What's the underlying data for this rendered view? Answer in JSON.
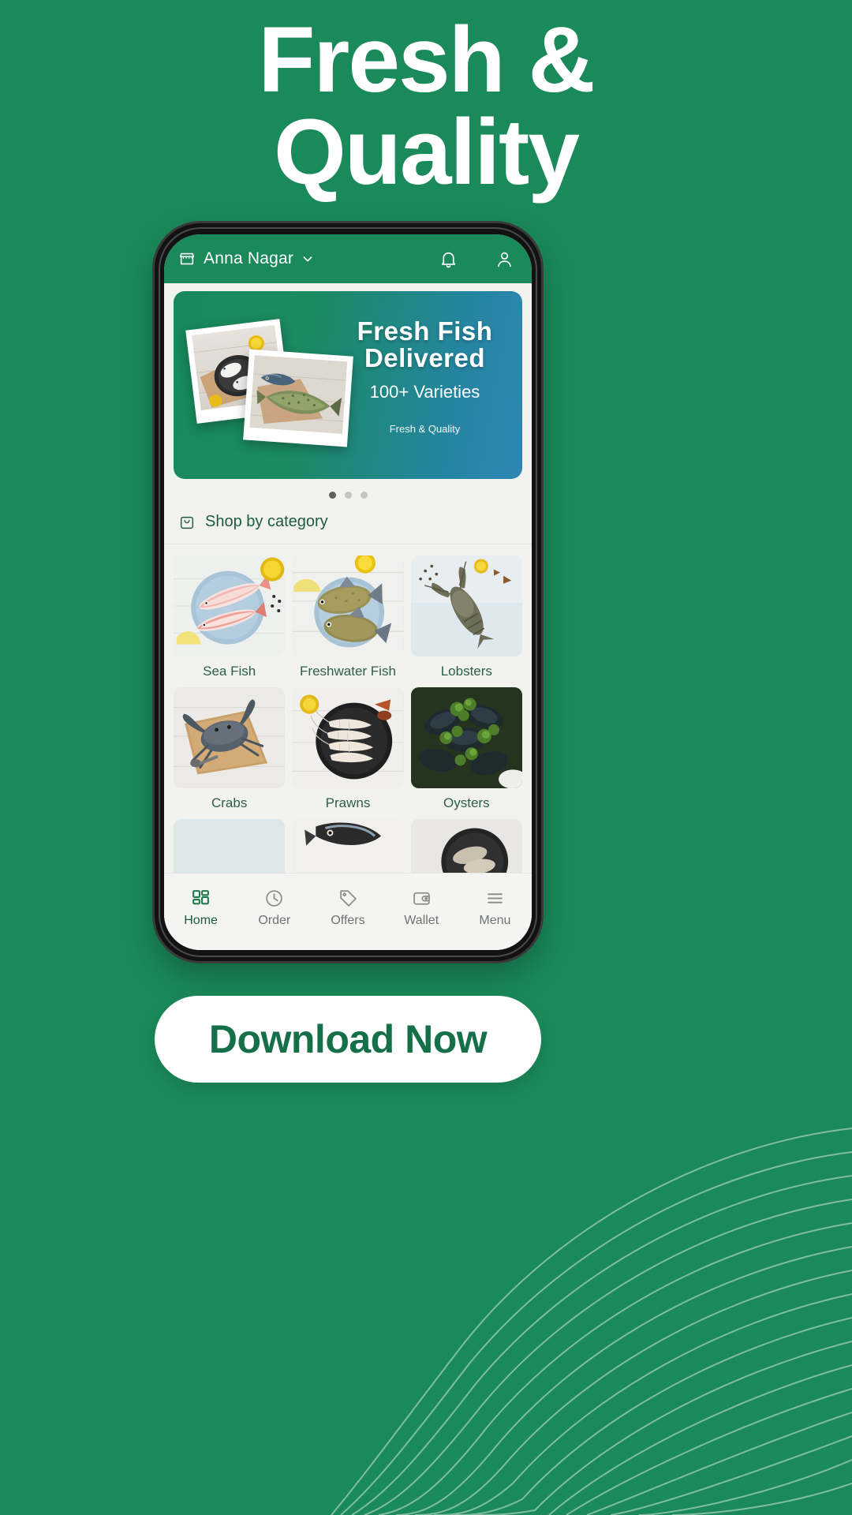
{
  "poster": {
    "headline_line1": "Fresh &",
    "headline_line2": "Quality",
    "background_color": "#1b8a5a",
    "cta_label": "Download Now",
    "cta_text_color": "#157049"
  },
  "app": {
    "header": {
      "store_icon": "store-icon",
      "location": "Anna Nagar",
      "chevron_icon": "chevron-down-icon",
      "bell_icon": "bell-icon",
      "profile_icon": "profile-icon",
      "background_color": "#1b8a5a"
    },
    "banner": {
      "title_line1": "Fresh Fish",
      "title_line2": "Delivered",
      "subtitle": "100+ Varieties",
      "tagline": "Fresh & Quality",
      "gradient_from": "#17895a",
      "gradient_to": "#2f86b4",
      "photos": [
        "fish-plate-photo",
        "whole-fish-photo"
      ],
      "dots": [
        {
          "active": true
        },
        {
          "active": false
        },
        {
          "active": false
        }
      ]
    },
    "section": {
      "icon": "shopping-bag-icon",
      "title": "Shop by category"
    },
    "categories": [
      {
        "label": "Sea Fish",
        "image": "sea-fish-photo"
      },
      {
        "label": "Freshwater Fish",
        "image": "freshwater-fish-photo"
      },
      {
        "label": "Lobsters",
        "image": "lobster-photo"
      },
      {
        "label": "Crabs",
        "image": "crab-photo"
      },
      {
        "label": "Prawns",
        "image": "prawn-photo"
      },
      {
        "label": "Oysters",
        "image": "oyster-photo"
      }
    ],
    "bottom_nav": [
      {
        "label": "Home",
        "icon": "grid-icon",
        "active": true
      },
      {
        "label": "Order",
        "icon": "clock-icon",
        "active": false
      },
      {
        "label": "Offers",
        "icon": "tag-icon",
        "active": false
      },
      {
        "label": "Wallet",
        "icon": "wallet-icon",
        "active": false
      },
      {
        "label": "Menu",
        "icon": "menu-icon",
        "active": false
      }
    ]
  }
}
